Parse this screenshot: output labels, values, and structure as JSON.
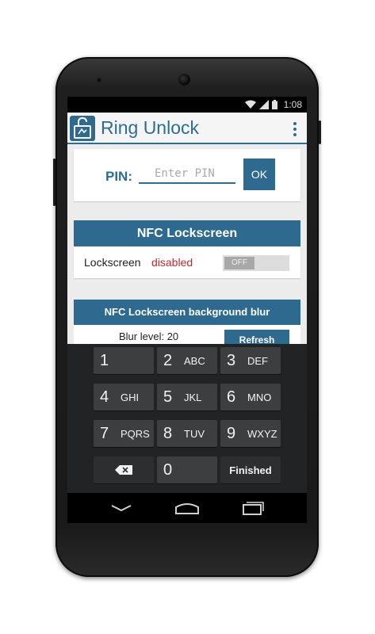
{
  "status_bar": {
    "time": "1:08"
  },
  "action_bar": {
    "title": "Ring Unlock"
  },
  "pin": {
    "label": "PIN:",
    "placeholder": "Enter PIN",
    "ok_label": "OK"
  },
  "nfc": {
    "header": "NFC Lockscreen",
    "lock_label": "Lockscreen",
    "lock_status": "disabled",
    "toggle_label": "OFF"
  },
  "blur": {
    "header": "NFC Lockscreen background blur",
    "level_label": "Blur level: 20",
    "button_label": "Refresh"
  },
  "keyboard": {
    "keys": [
      {
        "num": "1",
        "letters": ""
      },
      {
        "num": "2",
        "letters": "ABC"
      },
      {
        "num": "3",
        "letters": "DEF"
      },
      {
        "num": "4",
        "letters": "GHI"
      },
      {
        "num": "5",
        "letters": "JKL"
      },
      {
        "num": "6",
        "letters": "MNO"
      },
      {
        "num": "7",
        "letters": "PQRS"
      },
      {
        "num": "8",
        "letters": "TUV"
      },
      {
        "num": "9",
        "letters": "WXYZ"
      }
    ],
    "zero": "0",
    "finished_label": "Finished",
    "backspace_icon": "backspace-icon"
  },
  "colors": {
    "primary": "#2e6a90",
    "status_disabled": "#c62828",
    "keyboard_bg": "#222324",
    "key_bg": "#3d3e40"
  }
}
